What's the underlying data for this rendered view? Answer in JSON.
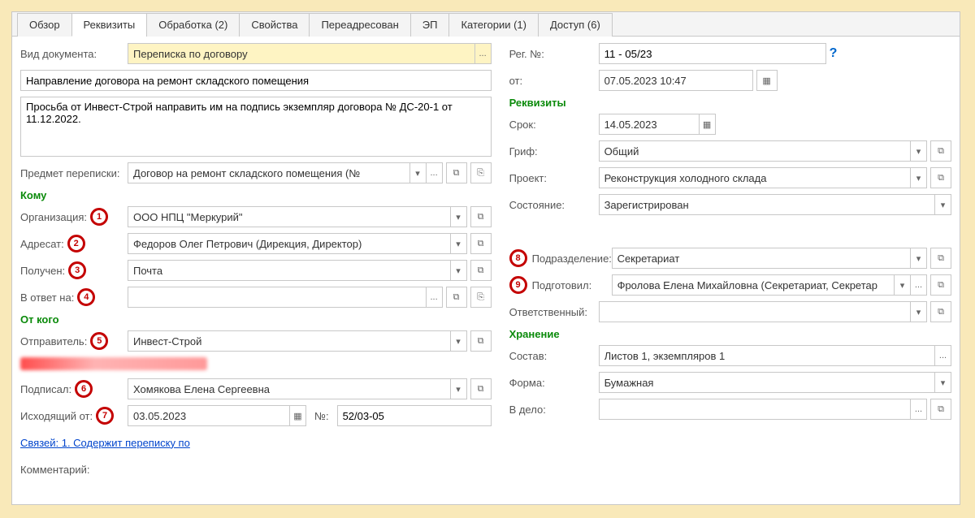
{
  "tabs": [
    "Обзор",
    "Реквизиты",
    "Обработка (2)",
    "Свойства",
    "Переадресован",
    "ЭП",
    "Категории (1)",
    "Доступ (6)"
  ],
  "activeTab": 1,
  "left": {
    "docTypeLabel": "Вид документа:",
    "docType": "Переписка по договору",
    "subject": "Направление договора на ремонт складского помещения",
    "description": "Просьба от Инвест-Строй направить им на подпись экземпляр договора № ДС-20-1 от 11.12.2022.",
    "subjOfCorrLabel": "Предмет переписки:",
    "subjOfCorr": "Договор на ремонт складского помещения (№",
    "toSection": "Кому",
    "orgLabel": "Организация:",
    "org": "ООО НПЦ \"Меркурий\"",
    "addresseeLabel": "Адресат:",
    "addressee": "Федоров Олег Петрович (Дирекция, Директор)",
    "receivedLabel": "Получен:",
    "received": "Почта",
    "inReplyLabel": "В ответ на:",
    "inReply": "",
    "fromSection": "От кого",
    "senderLabel": "Отправитель:",
    "sender": "Инвест-Строй",
    "signedLabel": "Подписал:",
    "signed": "Хомякова Елена Сергеевна",
    "outFromLabel": "Исходящий от:",
    "outFromDate": "03.05.2023",
    "outNoLabel": "№:",
    "outNo": "52/03-05",
    "linksLabel": "Связей: 1. Содержит переписку по",
    "commentLabel": "Комментарий:"
  },
  "right": {
    "regNoLabel": "Рег. №:",
    "regNo": "11 - 05/23",
    "fromDateLabel": "от:",
    "fromDate": "07.05.2023 10:47",
    "detailsSection": "Реквизиты",
    "deadlineLabel": "Срок:",
    "deadline": "14.05.2023",
    "classificationLabel": "Гриф:",
    "classification": "Общий",
    "projectLabel": "Проект:",
    "project": "Реконструкция холодного склада",
    "stateLabel": "Состояние:",
    "state": "Зарегистрирован",
    "deptLabel": "Подразделение:",
    "dept": "Секретариат",
    "preparedLabel": "Подготовил:",
    "prepared": "Фролова Елена Михайловна (Секретариат, Секретар",
    "responsibleLabel": "Ответственный:",
    "responsible": "",
    "storageSection": "Хранение",
    "compositionLabel": "Состав:",
    "composition": "Листов 1, экземпляров 1",
    "formLabel": "Форма:",
    "form": "Бумажная",
    "inCaseLabel": "В дело:",
    "inCase": ""
  },
  "glyphs": {
    "caret": "▾",
    "dots": "...",
    "open": "⧉",
    "copy": "⎘",
    "calendar": "▦",
    "help": "?"
  },
  "badges": {
    "b1": "1",
    "b2": "2",
    "b3": "3",
    "b4": "4",
    "b5": "5",
    "b6": "6",
    "b7": "7",
    "b8": "8",
    "b9": "9"
  }
}
